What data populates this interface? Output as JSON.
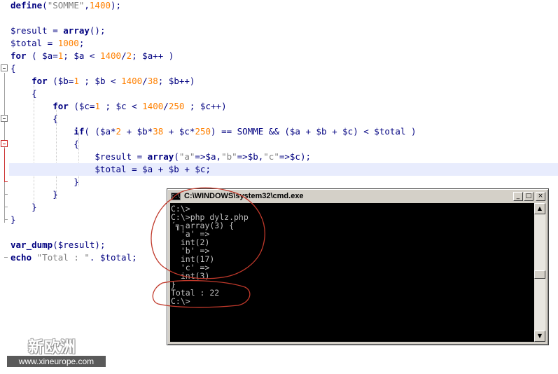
{
  "editor": {
    "lines": [
      "define(\"SOMME\",1400);",
      "",
      "$result = array();",
      "$total = 1000;",
      "for ( $a=1; $a < 1400/2; $a++ )",
      "{",
      "    for ($b=1 ; $b < 1400/38; $b++)",
      "    {",
      "        for ($c=1 ; $c < 1400/250 ; $c++)",
      "        {",
      "            if( ($a*2 + $b*38 + $c*250) == SOMME && ($a + $b + $c) < $total )",
      "            {",
      "                $result = array(\"a\"=>$a,\"b\"=>$b,\"c\"=>$c);",
      "                $total = $a + $b + $c;",
      "            }",
      "        }",
      "    }",
      "}",
      "",
      "var_dump($result);",
      "echo \"Total : \". $total;"
    ]
  },
  "cmd": {
    "title": "C:\\WINDOWS\\system32\\cmd.exe",
    "icon_label": "C:\\",
    "buttons": {
      "minimize": "_",
      "maximize": "□",
      "close": "×"
    },
    "output": [
      "C:\\>",
      "C:\\>php dylz.php",
      "´╗┐array(3) {",
      "  'a' =>",
      "  int(2)",
      "  'b' =>",
      "  int(17)",
      "  'c' =>",
      "  int(3)",
      "}",
      "Total : 22",
      "C:\\>"
    ]
  },
  "watermark": {
    "site_name": "新欧洲",
    "url": "www.xineurope.com"
  },
  "colors": {
    "keyword": "#000080",
    "number": "#ff8000",
    "string": "#808080",
    "current_line": "#e8ecfd",
    "console_bg": "#000000",
    "console_fg": "#c0c0c0",
    "annotation": "#c0392b"
  }
}
